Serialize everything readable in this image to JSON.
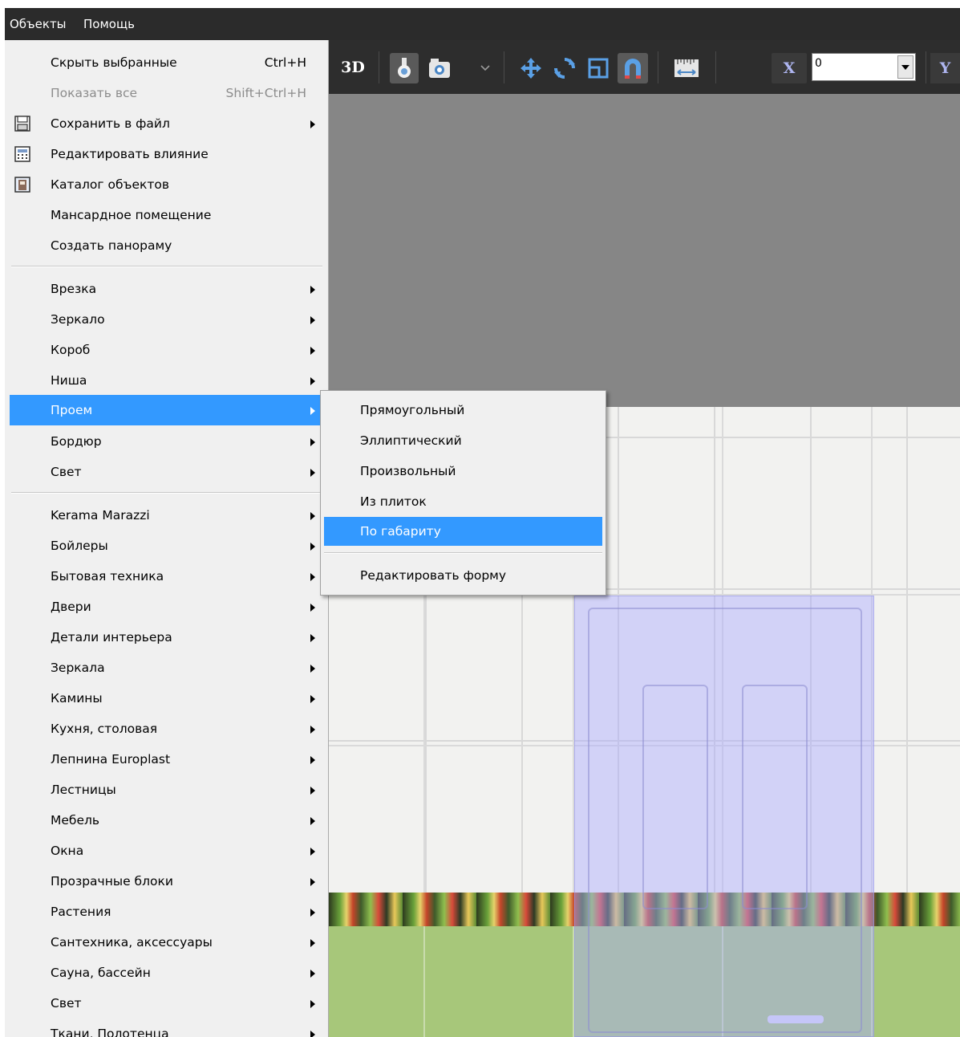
{
  "menubar": {
    "objects": "Объекты",
    "help": "Помощь"
  },
  "toolbar": {
    "view_3d": "3D",
    "x_label": "X",
    "x_value": "0",
    "y_label": "Y"
  },
  "main_menu": {
    "hide_selected": {
      "label": "Скрыть выбранные",
      "shortcut": "Ctrl+H"
    },
    "show_all": {
      "label": "Показать все",
      "shortcut": "Shift+Ctrl+H"
    },
    "save_to_file": "Сохранить в файл",
    "edit_influence": "Редактировать влияние",
    "object_catalog": "Каталог объектов",
    "attic_room": "Мансардное помещение",
    "create_panorama": "Создать панораму",
    "group2": [
      "Врезка",
      "Зеркало",
      "Короб",
      "Ниша",
      "Проем",
      "Бордюр",
      "Свет"
    ],
    "group3": [
      "Kerama Marazzi",
      "Бойлеры",
      "Бытовая техника",
      "Двери",
      "Детали интерьера",
      "Зеркала",
      "Камины",
      "Кухня, столовая",
      "Лепнина Europlast",
      "Лестницы",
      "Мебель",
      "Окна",
      "Прозрачные блоки",
      "Растения",
      "Сантехника, аксессуары",
      "Сауна, бассейн",
      "Свет",
      "Ткани, Полотенца"
    ]
  },
  "sub_menu": {
    "items": [
      "Прямоугольный",
      "Эллиптический",
      "Произвольный",
      "Из плиток",
      "По габариту"
    ],
    "edit_shape": "Редактировать форму"
  },
  "colors": {
    "menubar_bg": "#2b2b2b",
    "toolbar_bg": "#2d2d2d",
    "menu_bg": "#f0f0f0",
    "highlight": "#3399ff"
  },
  "icons": [
    "floppy-icon",
    "calculator-icon",
    "catalog-icon",
    "lamp-icon",
    "camera-icon",
    "move-icon",
    "rotate-icon",
    "scale-icon",
    "magnet-icon",
    "ruler-icon"
  ]
}
